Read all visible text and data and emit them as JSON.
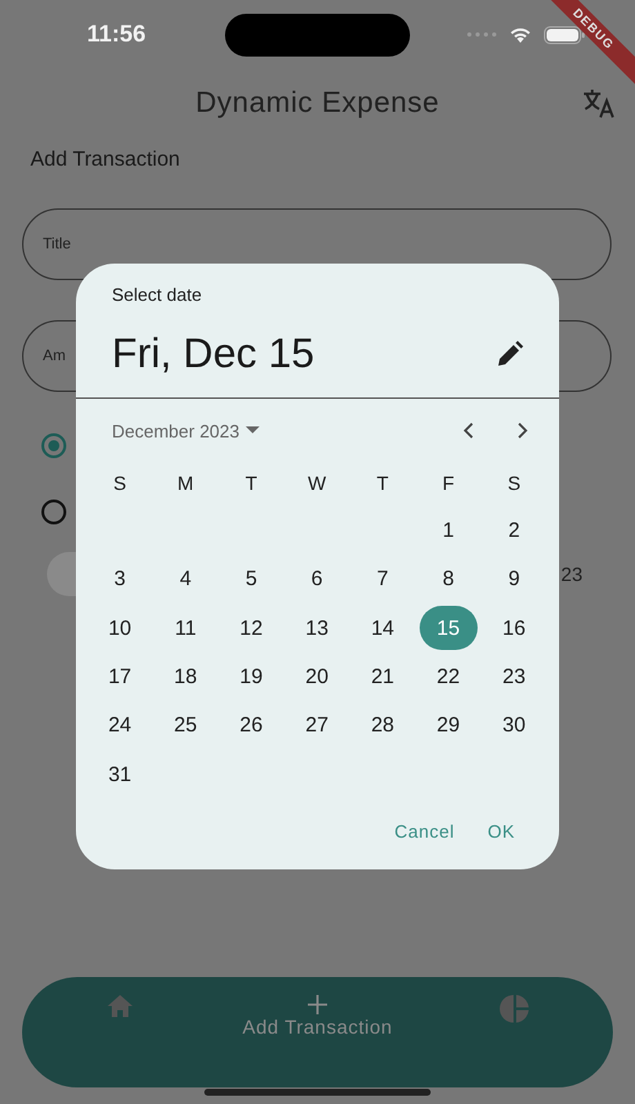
{
  "status_bar": {
    "time": "11:56"
  },
  "debug_banner": "DEBUG",
  "app_bar": {
    "title": "Dynamic Expense"
  },
  "form": {
    "heading": "Add Transaction",
    "fields": [
      {
        "label": "Title"
      },
      {
        "label": "Am"
      }
    ],
    "radios": [
      {
        "selected": true
      },
      {
        "selected": false
      }
    ],
    "date_text": "23"
  },
  "date_picker": {
    "header": "Select date",
    "selected_date": "Fri, Dec 15",
    "month": "December 2023",
    "weekdays": [
      "S",
      "M",
      "T",
      "W",
      "T",
      "F",
      "S"
    ],
    "weeks": [
      [
        {
          "label": "1",
          "selected": false
        },
        {
          "label": "2",
          "selected": false
        }
      ],
      [
        {
          "label": "3",
          "selected": false
        },
        {
          "label": "4",
          "selected": false
        },
        {
          "label": "5",
          "selected": false
        },
        {
          "label": "6",
          "selected": false
        },
        {
          "label": "7",
          "selected": false
        },
        {
          "label": "8",
          "selected": false
        },
        {
          "label": "9",
          "selected": false
        }
      ],
      [
        {
          "label": "10",
          "selected": false
        },
        {
          "label": "11",
          "selected": false
        },
        {
          "label": "12",
          "selected": false
        },
        {
          "label": "13",
          "selected": false
        },
        {
          "label": "14",
          "selected": false
        },
        {
          "label": "15",
          "selected": true
        },
        {
          "label": "16",
          "selected": false
        }
      ],
      [
        {
          "label": "17",
          "selected": false
        },
        {
          "label": "18",
          "selected": false
        },
        {
          "label": "19",
          "selected": false
        },
        {
          "label": "20",
          "selected": false
        },
        {
          "label": "21",
          "selected": false
        },
        {
          "label": "22",
          "selected": false
        },
        {
          "label": "23",
          "selected": false
        }
      ],
      [
        {
          "label": "24",
          "selected": false
        },
        {
          "label": "25",
          "selected": false
        },
        {
          "label": "26",
          "selected": false
        },
        {
          "label": "27",
          "selected": false
        },
        {
          "label": "28",
          "selected": false
        },
        {
          "label": "29",
          "selected": false
        },
        {
          "label": "30",
          "selected": false
        }
      ],
      [
        {
          "label": "31",
          "selected": false
        }
      ]
    ],
    "actions": [
      "Cancel",
      "OK"
    ]
  },
  "bottom_nav": [
    {
      "kind": "home"
    },
    {
      "kind": "add",
      "label": "Add Transaction"
    },
    {
      "kind": "chart"
    }
  ]
}
